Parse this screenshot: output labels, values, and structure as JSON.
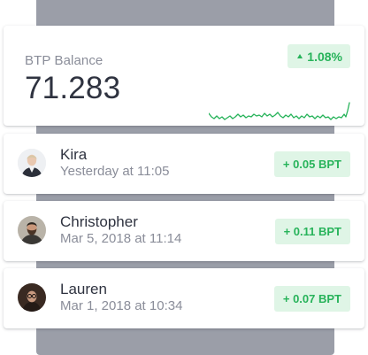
{
  "balance": {
    "label": "BTP Balance",
    "value": "71.283",
    "change": "1.08%",
    "change_direction": "up",
    "sparkline_icon": "trend-sparkline"
  },
  "transactions": [
    {
      "name": "Kira",
      "date": "Yesterday at 11:05",
      "amount": "+ 0.05 BPT",
      "avatar_icon": "person-avatar-icon"
    },
    {
      "name": "Christopher",
      "date": "Mar 5, 2018 at 11:14",
      "amount": "+ 0.11 BPT",
      "avatar_icon": "person-avatar-icon"
    },
    {
      "name": "Lauren",
      "date": "Mar 1, 2018 at 10:34",
      "amount": "+ 0.07 BPT",
      "avatar_icon": "person-avatar-icon"
    }
  ],
  "colors": {
    "positive": "#27b35a",
    "positive_bg": "#dff5e6",
    "backdrop": "#9b9ea8",
    "text_primary": "#2f3340",
    "text_secondary": "#8a8d99"
  }
}
